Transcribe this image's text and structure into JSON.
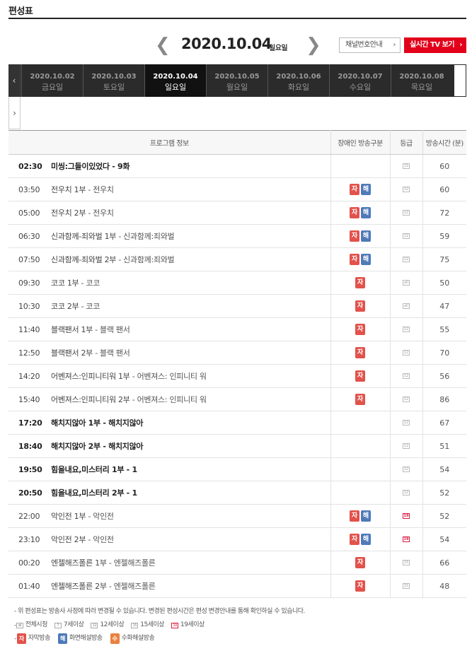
{
  "page": {
    "title": "편성표"
  },
  "date_nav": {
    "prev_icon": "chevron-left-icon",
    "next_icon": "chevron-right-icon",
    "date": "2020.10.04",
    "weekday": "일요일",
    "prev_glyph": "❮",
    "next_glyph": "❯",
    "channel_button": "채널번호안내",
    "live_button": "실시간 TV 보기",
    "button_chevron": "›"
  },
  "day_strip": {
    "left_glyph": "‹",
    "right_glyph": "›",
    "days": [
      {
        "date": "2020.10.02",
        "weekday": "금요일"
      },
      {
        "date": "2020.10.03",
        "weekday": "토요일"
      },
      {
        "date": "2020.10.04",
        "weekday": "일요일"
      },
      {
        "date": "2020.10.05",
        "weekday": "월요일"
      },
      {
        "date": "2020.10.06",
        "weekday": "화요일"
      },
      {
        "date": "2020.10.07",
        "weekday": "수요일"
      },
      {
        "date": "2020.10.08",
        "weekday": "목요일"
      }
    ]
  },
  "table": {
    "headers": {
      "info": "프로그램 정보",
      "accessibility": "장애인 방송구분",
      "grade": "등급",
      "duration": "방송시간 (분)"
    },
    "rows": [
      {
        "time": "02:30",
        "program": "미씽:그들이있었다",
        "sub": " - 9화",
        "bold": true,
        "ja": false,
        "hae": false,
        "grade": "15",
        "duration": "60"
      },
      {
        "time": "03:50",
        "program": "전우치 1부",
        "sub": " - 전우치",
        "bold": false,
        "ja": true,
        "hae": true,
        "grade": "12",
        "duration": "60"
      },
      {
        "time": "05:00",
        "program": "전우치 2부",
        "sub": " - 전우치",
        "bold": false,
        "ja": true,
        "hae": true,
        "grade": "12",
        "duration": "72"
      },
      {
        "time": "06:30",
        "program": "신과함께-죄와벌 1부",
        "sub": " - 신과함께:죄와벌",
        "bold": false,
        "ja": true,
        "hae": true,
        "grade": "12",
        "duration": "59"
      },
      {
        "time": "07:50",
        "program": "신과함께-죄와벌 2부",
        "sub": " - 신과함께:죄와벌",
        "bold": false,
        "ja": true,
        "hae": true,
        "grade": "12",
        "duration": "75"
      },
      {
        "time": "09:30",
        "program": "코코 1부",
        "sub": " - 코코",
        "bold": false,
        "ja": true,
        "hae": false,
        "grade": "all",
        "duration": "50"
      },
      {
        "time": "10:30",
        "program": "코코 2부",
        "sub": " - 코코",
        "bold": false,
        "ja": true,
        "hae": false,
        "grade": "all",
        "duration": "47"
      },
      {
        "time": "11:40",
        "program": "블랙팬서 1부",
        "sub": " - 블랙 팬서",
        "bold": false,
        "ja": true,
        "hae": false,
        "grade": "12",
        "duration": "55"
      },
      {
        "time": "12:50",
        "program": "블랙팬서 2부",
        "sub": " - 블랙 팬서",
        "bold": false,
        "ja": true,
        "hae": false,
        "grade": "12",
        "duration": "70"
      },
      {
        "time": "14:20",
        "program": "어벤져스:인피니티워 1부",
        "sub": " - 어벤져스: 인피니티 워",
        "bold": false,
        "ja": true,
        "hae": false,
        "grade": "12",
        "duration": "56"
      },
      {
        "time": "15:40",
        "program": "어벤져스:인피니티워 2부",
        "sub": " - 어벤져스: 인피니티 워",
        "bold": false,
        "ja": true,
        "hae": false,
        "grade": "12",
        "duration": "86"
      },
      {
        "time": "17:20",
        "program": "해치지않아 1부",
        "sub": " - 해치지않아",
        "bold": true,
        "ja": false,
        "hae": false,
        "grade": "12",
        "duration": "67"
      },
      {
        "time": "18:40",
        "program": "해치지않아 2부",
        "sub": " - 해치지않아",
        "bold": true,
        "ja": false,
        "hae": false,
        "grade": "12",
        "duration": "51"
      },
      {
        "time": "19:50",
        "program": "힘을내요,미스터리 1부",
        "sub": " - 1",
        "bold": true,
        "ja": false,
        "hae": false,
        "grade": "12",
        "duration": "54"
      },
      {
        "time": "20:50",
        "program": "힘을내요,미스터리 2부",
        "sub": " - 1",
        "bold": true,
        "ja": false,
        "hae": false,
        "grade": "12",
        "duration": "52"
      },
      {
        "time": "22:00",
        "program": "악인전 1부",
        "sub": " - 악인전",
        "bold": false,
        "ja": true,
        "hae": true,
        "grade": "19",
        "duration": "52"
      },
      {
        "time": "23:10",
        "program": "악인전 2부",
        "sub": " - 악인전",
        "bold": false,
        "ja": true,
        "hae": true,
        "grade": "19",
        "duration": "54"
      },
      {
        "time": "00:20",
        "program": "엔젤해즈폴른 1부",
        "sub": " - 엔젤해즈폴른",
        "bold": false,
        "ja": true,
        "hae": false,
        "grade": "15",
        "duration": "66"
      },
      {
        "time": "01:40",
        "program": "엔젤해즈폴른 2부",
        "sub": " - 엔젤해즈폴른",
        "bold": false,
        "ja": true,
        "hae": false,
        "grade": "15",
        "duration": "48"
      }
    ]
  },
  "badges": {
    "ja": "자",
    "hae": "해",
    "su": "수"
  },
  "grades": {
    "all": "all",
    "7": "7",
    "12": "12",
    "15": "15",
    "19": "19"
  },
  "notes": {
    "line1": "- 위 편성표는 방송사 사정에 따라 변경될 수 있습니다. 변경된 편성시간은 편성 변경안내를 통해 확인하실 수 있습니다.",
    "dash": "-",
    "grade_legend": [
      "전체시청",
      "7세이상",
      "12세이상",
      "15세이상",
      "19세이상"
    ],
    "badge_legend": [
      "자막방송",
      "화면해설방송",
      "수화해설방송"
    ]
  },
  "colors": {
    "accent": "#e2001a",
    "ja_badge": "#e2524c",
    "hae_badge": "#4f7ab9",
    "su_badge": "#e9813f",
    "grade19": "#d81b3f"
  }
}
